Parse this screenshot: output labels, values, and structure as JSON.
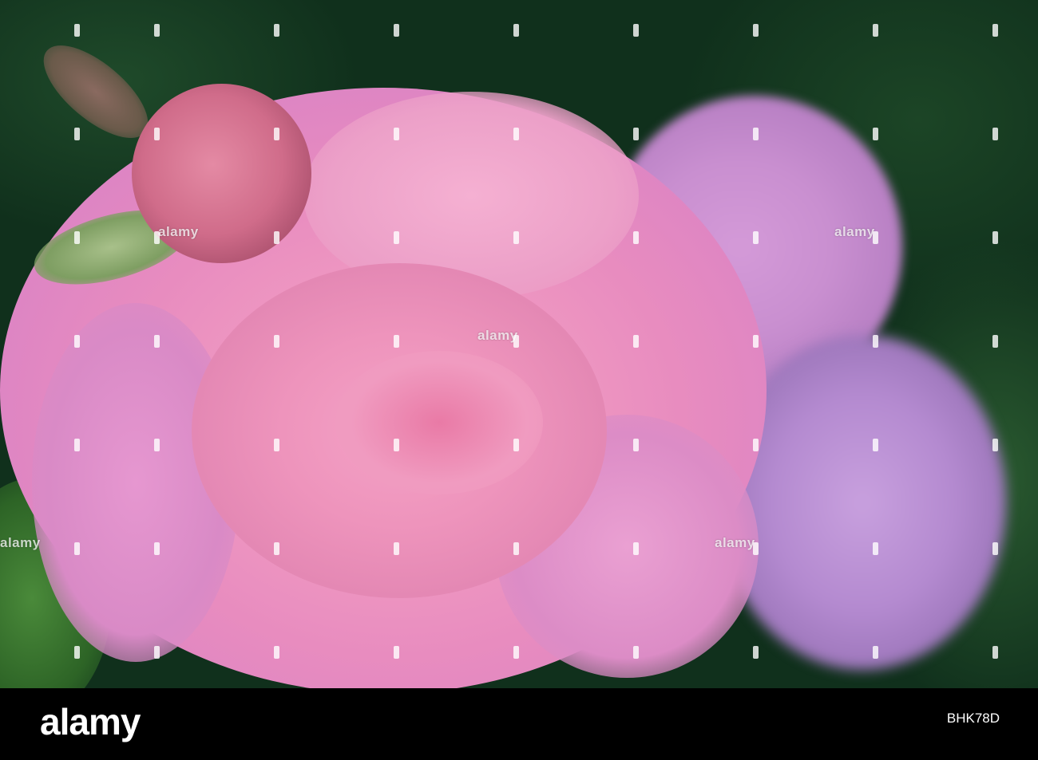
{
  "image": {
    "subject": "pink rose",
    "watermark_text": "alamy"
  },
  "footer": {
    "logo": "alamy",
    "image_code": "BHK78D"
  },
  "colors": {
    "rose_pink": "#f09ac2",
    "background_green": "#10301c",
    "footer_black": "#000000"
  }
}
